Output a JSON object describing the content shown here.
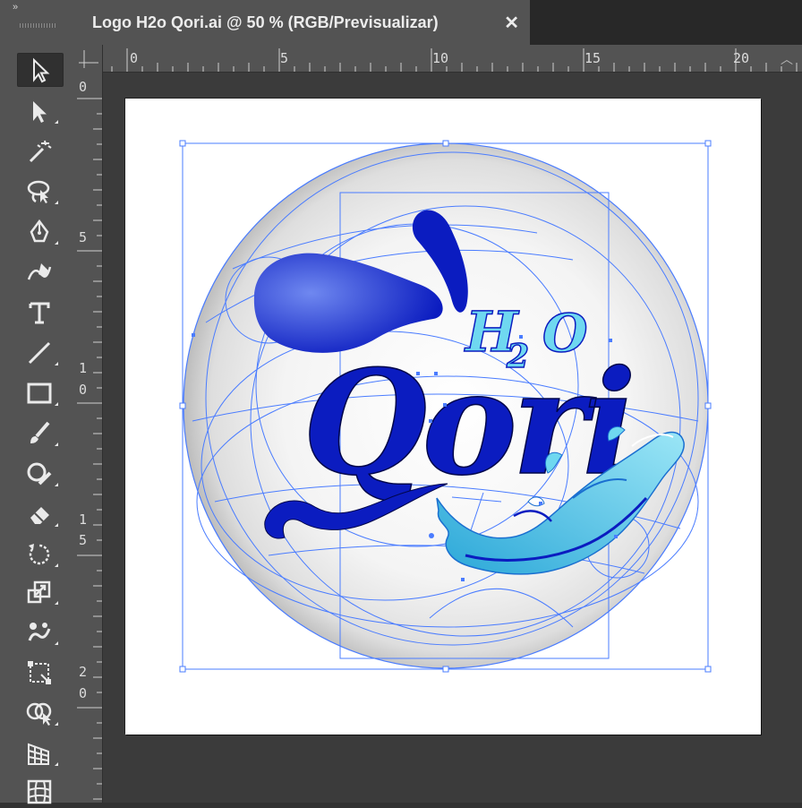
{
  "document": {
    "tab_title": "Logo H2o Qori.ai @ 50 % (RGB/Previsualizar)",
    "close_glyph": "✕"
  },
  "panel": {
    "collapse_glyph": "»"
  },
  "tools": [
    {
      "name": "selection-tool",
      "icon": "selection-arrow-icon",
      "active": true
    },
    {
      "name": "direct-selection-tool",
      "icon": "direct-selection-arrow-icon"
    },
    {
      "name": "magic-wand-tool",
      "icon": "magic-wand-icon"
    },
    {
      "name": "lasso-tool",
      "icon": "lasso-icon"
    },
    {
      "name": "pen-tool",
      "icon": "pen-icon"
    },
    {
      "name": "curvature-tool",
      "icon": "curvature-pen-icon"
    },
    {
      "name": "type-tool",
      "icon": "type-T-icon"
    },
    {
      "name": "line-segment-tool",
      "icon": "line-icon"
    },
    {
      "name": "rectangle-tool",
      "icon": "rectangle-icon"
    },
    {
      "name": "paintbrush-tool",
      "icon": "paintbrush-icon"
    },
    {
      "name": "shaper-tool",
      "icon": "shaper-icon"
    },
    {
      "name": "eraser-tool",
      "icon": "eraser-icon"
    },
    {
      "name": "rotate-tool",
      "icon": "rotate-icon"
    },
    {
      "name": "scale-tool",
      "icon": "scale-icon"
    },
    {
      "name": "puppet-warp-tool",
      "icon": "puppet-warp-icon"
    },
    {
      "name": "free-transform-tool",
      "icon": "free-transform-icon"
    },
    {
      "name": "shape-builder-tool",
      "icon": "shape-builder-icon"
    },
    {
      "name": "perspective-grid-tool",
      "icon": "perspective-grid-icon"
    },
    {
      "name": "mesh-tool",
      "icon": "mesh-icon"
    }
  ],
  "rulers": {
    "top": [
      "0",
      "5",
      "10",
      "15",
      "20"
    ],
    "left": [
      [
        "0"
      ],
      [
        "5"
      ],
      [
        "1",
        "0"
      ],
      [
        "1",
        "5"
      ],
      [
        "2",
        "0"
      ]
    ]
  },
  "artwork": {
    "brand_script": "Qori",
    "h2o_letters": [
      "H",
      "2",
      "O"
    ],
    "colors": {
      "deep_blue": "#0b1cc0",
      "mid_blue": "#3a52e0",
      "light_cyan": "#6fd8f0",
      "cyan_dark": "#2aa7d8",
      "outline_selection": "#4a7cff",
      "sphere_shadow": "#b9b9b9"
    }
  }
}
